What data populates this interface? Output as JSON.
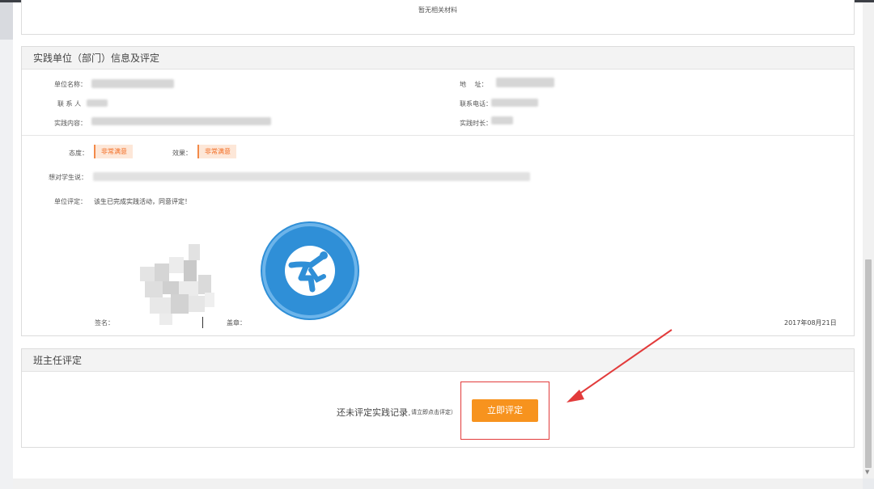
{
  "top_card": {
    "no_material": "暂无相关材料"
  },
  "unit_section": {
    "title": "实践单位（部门）信息及评定",
    "unit_name_label": "单位名称：",
    "address_label": "地　 址：",
    "contact_label": "联 系 人",
    "phone_label": "联系电话：",
    "content_label": "实践内容：",
    "duration_label": "实践时长：",
    "attitude_label": "态度：",
    "attitude_value": "非常满意",
    "effect_label": "效果：",
    "effect_value": "非常满意",
    "message_label": "想对学生说：",
    "evaluation_label": "单位评定：",
    "evaluation_value": "该生已完成实践活动，同意评定！",
    "signature_label": "签名：",
    "seal_label": "盖章：",
    "date": "2017年08月21日"
  },
  "teacher_section": {
    "title": "班主任评定",
    "pending_text": "还未评定实践记录.",
    "hint_text": "请立即点击评定）",
    "action_label": "立即评定"
  },
  "colors": {
    "accent": "#f7931e",
    "highlight": "#e23b3b",
    "stamp": "#2f8fd7"
  }
}
